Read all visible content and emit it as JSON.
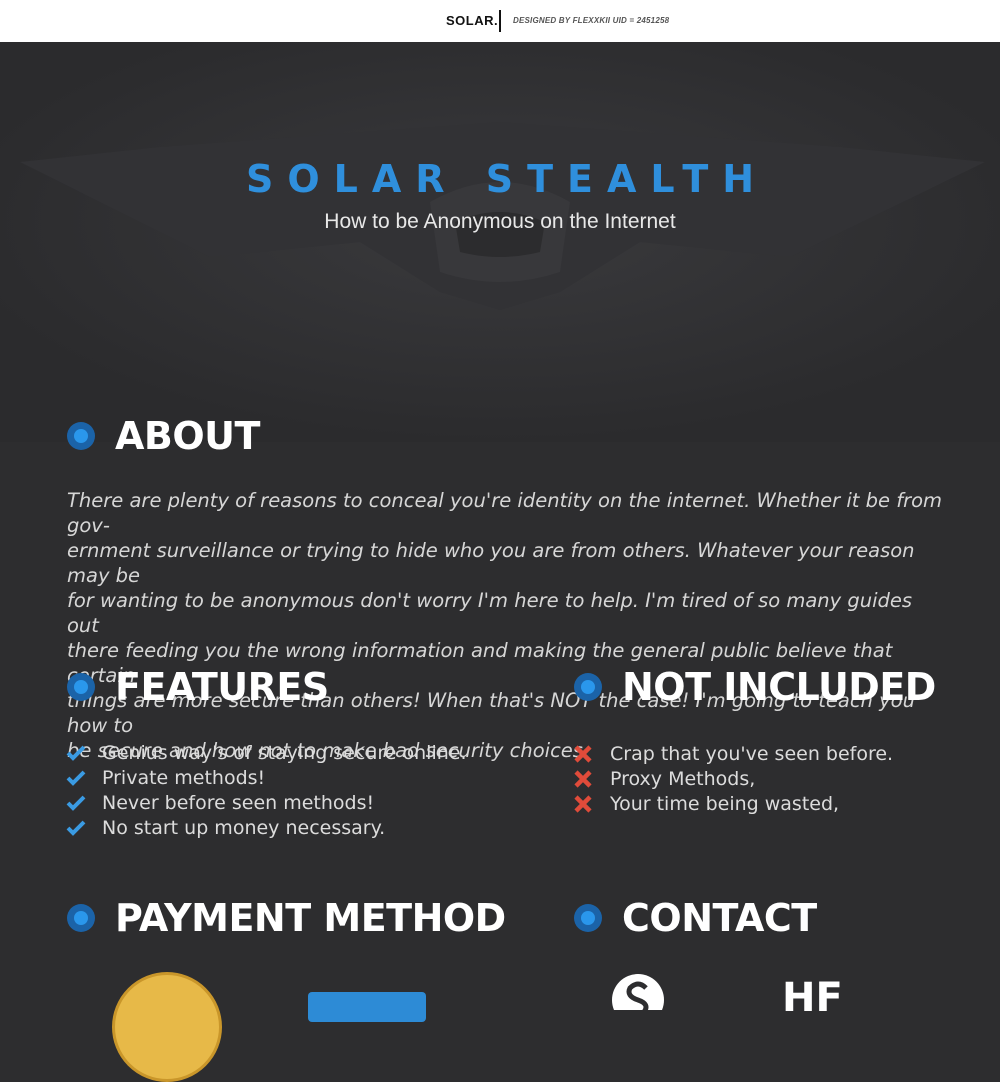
{
  "topbar": {
    "brand": "SOLAR.",
    "credit": "DESIGNED BY FLEXXKII UID = 2451258"
  },
  "hero": {
    "title": "SOLAR STEALTH",
    "subtitle": "How to be Anonymous on the Internet"
  },
  "about": {
    "heading": "ABOUT",
    "lines": [
      "There are plenty of reasons to conceal you're identity on the internet. Whether it be from gov-",
      "ernment surveillance or trying to hide who you are from others. Whatever your reason may be",
      "for wanting to be anonymous don't worry I'm here to help. I'm tired of so many guides out",
      "there feeding you the wrong information and making the general public believe that certain",
      "things are more secure than others! When that's NOT the case! I'm going to teach you how to",
      "be secure and how not to make bad security choices."
    ]
  },
  "features": {
    "heading": "FEATURES",
    "items": [
      "Genius way's of staying secure online.",
      "Private methods!",
      "Never before seen methods!",
      "No start up money necessary."
    ]
  },
  "not_included": {
    "heading": "NOT INCLUDED",
    "items": [
      "Crap that you've seen before.",
      "Proxy Methods,",
      "Your time being wasted,"
    ]
  },
  "payment": {
    "heading": "PAYMENT METHOD"
  },
  "contact": {
    "heading": "CONTACT",
    "logo_text": "HF"
  },
  "colors": {
    "accent": "#2f8fdc",
    "check": "#3a9be3",
    "cross": "#e04b3a",
    "background": "#2d2d2f"
  },
  "icons": [
    "check-icon",
    "cross-icon",
    "bullet-dot-icon",
    "skype-icon",
    "coin-icon"
  ]
}
